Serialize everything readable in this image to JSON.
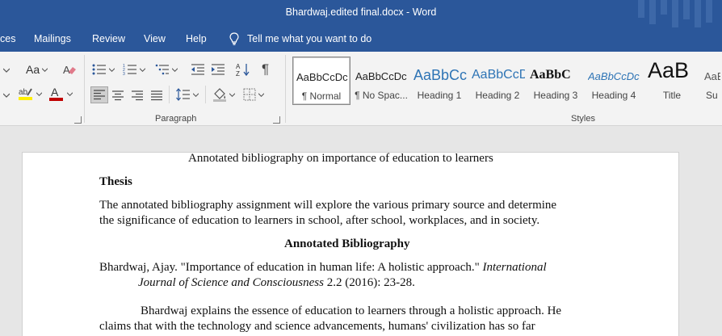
{
  "titlebar": {
    "title": "Bhardwaj.edited final.docx  -  Word"
  },
  "menu": {
    "tabs": [
      "ces",
      "Mailings",
      "Review",
      "View",
      "Help"
    ],
    "tell_me": "Tell me what you want to do"
  },
  "ribbon": {
    "font_group": {
      "font_size_btn": "Aa"
    },
    "paragraph_label": "Paragraph",
    "styles_label": "Styles",
    "styles": [
      {
        "sample": "AaBbCcDc",
        "name": "¶ Normal"
      },
      {
        "sample": "AaBbCcDc",
        "name": "¶ No Spac..."
      },
      {
        "sample": "AaBbCc",
        "name": "Heading 1"
      },
      {
        "sample": "AaBbCcD",
        "name": "Heading 2"
      },
      {
        "sample": "AaBbC",
        "name": "Heading 3"
      },
      {
        "sample": "AaBbCcDc",
        "name": "Heading 4"
      },
      {
        "sample": "AaB",
        "name": "Title"
      },
      {
        "sample": "AaB",
        "name": "Su"
      }
    ]
  },
  "document": {
    "title_line": "Annotated bibliography on importance of education to learners",
    "thesis_heading": "Thesis",
    "thesis_line1": "The annotated bibliography assignment will explore the various primary source and determine",
    "thesis_line2": "the significance of education to learners in school, after school, workplaces, and in society.",
    "section_heading": "Annotated Bibliography",
    "cite_line1_text": "Bhardwaj, Ajay. \"Importance of education in human life: A holistic approach.\" ",
    "cite_line1_italic": "International",
    "cite_line2_italic": "Journal of Science and Consciousness",
    "cite_line2_text": " 2.2 (2016): 23-28.",
    "body_line1": "Bhardwaj explains the essence of education to learners through a holistic approach. He",
    "body_line2": "claims that with the technology and science advancements, humans' civilization has so far"
  },
  "colors": {
    "accent": "#2b579a",
    "ribbon_bg": "#f3f3f3",
    "doc_bg": "#e6e6e6"
  },
  "icons": [
    "lightbulb-icon",
    "bullets-icon",
    "numbering-icon",
    "multilevel-list-icon",
    "decrease-indent-icon",
    "increase-indent-icon",
    "sort-icon",
    "show-marks-icon",
    "align-left-icon",
    "center-icon",
    "align-right-icon",
    "justify-icon",
    "line-spacing-icon",
    "shading-icon",
    "borders-icon",
    "clear-formatting-icon",
    "highlight-icon",
    "font-color-icon"
  ]
}
